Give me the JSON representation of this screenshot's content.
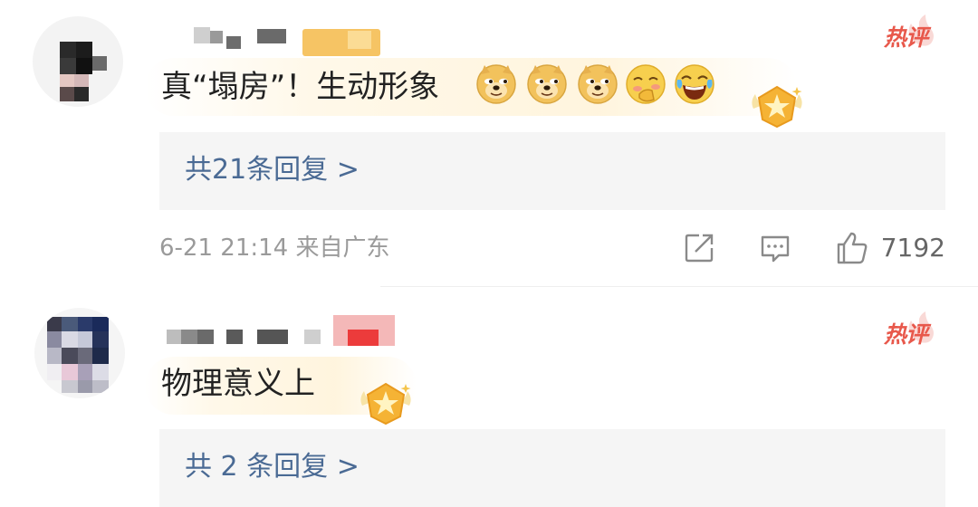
{
  "comments": [
    {
      "badge": "热评",
      "content": "真“塌房”！生动形象",
      "emojis": [
        "doge-emoji",
        "doge-emoji",
        "doge-emoji",
        "shy-face-emoji",
        "laugh-cry-emoji"
      ],
      "replies": "共21条回复 >",
      "timestamp": "6-21 21:14  来自广东",
      "likes": "7192"
    },
    {
      "badge": "热评",
      "content": "物理意义上",
      "replies": "共 2 条回复 >"
    }
  ],
  "colors": {
    "hot_badge": "#e8584b",
    "reply_link": "#4a6a94",
    "reply_box_bg": "#f5f5f5",
    "meta_text": "#9a9a9a",
    "icon_gray": "#8a8a8a"
  }
}
